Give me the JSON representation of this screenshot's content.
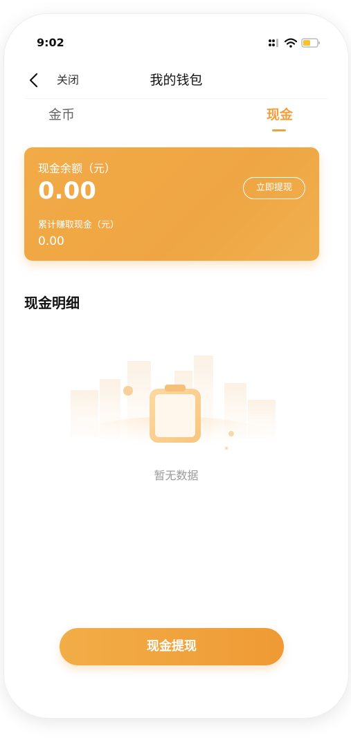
{
  "status_bar": {
    "time": "9:02",
    "icons": [
      "signal-icon",
      "wifi-icon",
      "battery-icon"
    ]
  },
  "nav": {
    "back_icon": "chevron-left-icon",
    "close_label": "关闭",
    "title": "我的钱包"
  },
  "tabs": [
    {
      "label": "金币",
      "active": false
    },
    {
      "label": "现金",
      "active": true
    }
  ],
  "card": {
    "balance_label": "现金余额（元）",
    "balance_value": "0.00",
    "withdraw_button": "立即提现",
    "earned_label": "累计赚取现金（元）",
    "earned_value": "0.00"
  },
  "details": {
    "title": "现金明细",
    "empty_icon": "empty-clipboard-icon",
    "empty_text": "暂无数据"
  },
  "bottom_button": {
    "label": "现金提现"
  },
  "colors": {
    "accent": "#f0a13e",
    "card_gradient_start": "#f1ab47",
    "card_gradient_end": "#f0b04f",
    "text_primary": "#111111",
    "text_muted": "#9a9a9a"
  }
}
